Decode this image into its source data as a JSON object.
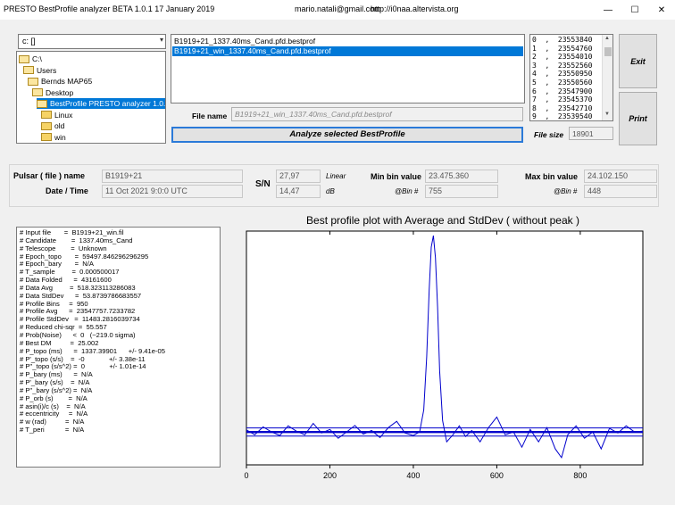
{
  "titlebar": {
    "app": "PRESTO BestProfile analyzer BETA 1.0.1   17 January 2019",
    "email": "mario.natali@gmail.com",
    "website": "http://i0naa.altervista.org",
    "minimize": "—",
    "maximize": "☐",
    "close": "✕"
  },
  "drive": {
    "value": "c: []",
    "dropdown": "▾"
  },
  "dirtree": [
    {
      "label": "C:\\",
      "level": 0,
      "open": true
    },
    {
      "label": "Users",
      "level": 1,
      "open": true
    },
    {
      "label": "Bernds MAP65",
      "level": 2,
      "open": true
    },
    {
      "label": "Desktop",
      "level": 3,
      "open": true
    },
    {
      "label": "BestProfile PRESTO analyzer 1.0.1.e",
      "level": 4,
      "open": true,
      "selected": true
    },
    {
      "label": "Linux",
      "level": 5,
      "open": false
    },
    {
      "label": "old",
      "level": 5,
      "open": false
    },
    {
      "label": "win",
      "level": 5,
      "open": false
    }
  ],
  "files": [
    {
      "name": "B1919+21_1337.40ms_Cand.pfd.bestprof",
      "selected": false
    },
    {
      "name": "B1919+21_win_1337.40ms_Cand.pfd.bestprof",
      "selected": true
    }
  ],
  "filename": {
    "label": "File name",
    "value": "B1919+21_win_1337.40ms_Cand.pfd.bestprof"
  },
  "analyze_label": "Analyze selected BestProfile",
  "valuelist": [
    "0  ,  23553840",
    "1  ,  23554760",
    "2  ,  23554010",
    "3  ,  23552560",
    "4  ,  23550950",
    "5  ,  23550560",
    "6  ,  23547900",
    "7  ,  23545370",
    "8  ,  23542710",
    "9  ,  23539540"
  ],
  "scroll": {
    "up": "▲",
    "down": "▼"
  },
  "filesize": {
    "label": "File size",
    "value": "18901"
  },
  "buttons": {
    "exit": "Exit",
    "print": "Print"
  },
  "info": {
    "pulsar_label": "Pulsar ( file ) name",
    "pulsar_value": "B1919+21",
    "date_label": "Date / Time",
    "date_value": "11 Oct 2021    9:0:0  UTC",
    "sn_label": "S/N",
    "sn_linear": "27,97",
    "sn_linear_unit": "Linear",
    "sn_db": "14,47",
    "sn_db_unit": "dB",
    "minbin_label": "Min bin value",
    "minbin_value": "23.475.360",
    "minbin_at_label": "@Bin #",
    "minbin_at": "755",
    "maxbin_label": "Max bin value",
    "maxbin_value": "24.102.150",
    "maxbin_at_label": "@Bin #",
    "maxbin_at": "448"
  },
  "params": [
    "# Input file       =  B1919+21_win.fil",
    "# Candidate        =  1337.40ms_Cand",
    "# Telescope        =  Unknown",
    "# Epoch_topo       =  59497.846296296295",
    "# Epoch_bary       =  N/A",
    "# T_sample         =  0.000500017",
    "# Data Folded      =  43161600",
    "# Data Avg         =  518.323113286083",
    "# Data StdDev      =  53.8739786683557",
    "# Profile Bins     =  950",
    "# Profile Avg      =  23547757.7233782",
    "# Profile StdDev   =  11483.2816039734",
    "# Reduced chi-sqr  =  55.557",
    "# Prob(Noise)      <  0   (~219.0 sigma)",
    "# Best DM          =  25.002",
    "# P_topo (ms)      =  1337.39901      +/- 9.41e-05",
    "# P'_topo (s/s)    =  -0             +/- 3.38e-11",
    "# P''_topo (s/s^2) =  0             +/- 1.01e-14",
    "# P_bary (ms)      =  N/A",
    "# P'_bary (s/s)    =  N/A",
    "# P''_bary (s/s^2) =  N/A",
    "# P_orb (s)        =  N/A",
    "# asin(i)/c (s)    =  N/A",
    "# eccentricity     =  N/A",
    "# w (rad)          =  N/A",
    "# T_peri           =  N/A"
  ],
  "chart_data": {
    "type": "line",
    "title": "Best profile plot with  Average and StdDev ( without peak )",
    "xlim": [
      0,
      950
    ],
    "ylim": [
      23455000,
      24115000
    ],
    "xticks": [
      0,
      200,
      400,
      600,
      800
    ],
    "x_tick_labels": [
      "0",
      "200",
      "400",
      "600",
      "800"
    ],
    "line_color": "#0000cc",
    "average": 23547757.7,
    "stddev": 11483.3,
    "peak": {
      "bin": 448,
      "value": 24102150
    },
    "min": {
      "bin": 755,
      "value": 23475360
    },
    "series": [
      {
        "x": [
          0,
          20,
          40,
          60,
          80,
          100,
          120,
          140,
          160,
          180,
          200,
          220,
          240,
          260,
          280,
          300,
          320,
          340,
          360,
          380,
          400,
          415,
          425,
          432,
          438,
          443,
          448,
          453,
          458,
          463,
          470,
          480,
          495,
          510,
          525,
          540,
          560,
          580,
          600,
          620,
          640,
          660,
          680,
          700,
          720,
          740,
          755,
          770,
          790,
          810,
          830,
          850,
          870,
          890,
          910,
          930,
          949
        ],
        "y": [
          23553840,
          23540000,
          23562000,
          23548000,
          23538000,
          23565000,
          23550000,
          23540000,
          23572000,
          23545000,
          23555000,
          23530000,
          23548000,
          23566000,
          23542000,
          23552000,
          23532000,
          23560000,
          23578000,
          23545000,
          23538000,
          23548000,
          23610000,
          23760000,
          23950000,
          24070000,
          24102150,
          24040000,
          23900000,
          23720000,
          23580000,
          23520000,
          23540000,
          23565000,
          23535000,
          23552000,
          23520000,
          23560000,
          23590000,
          23540000,
          23548000,
          23505000,
          23555000,
          23520000,
          23560000,
          23500000,
          23475360,
          23540000,
          23565000,
          23530000,
          23548000,
          23500000,
          23558000,
          23545000,
          23565000,
          23548000,
          23550000
        ]
      }
    ]
  }
}
